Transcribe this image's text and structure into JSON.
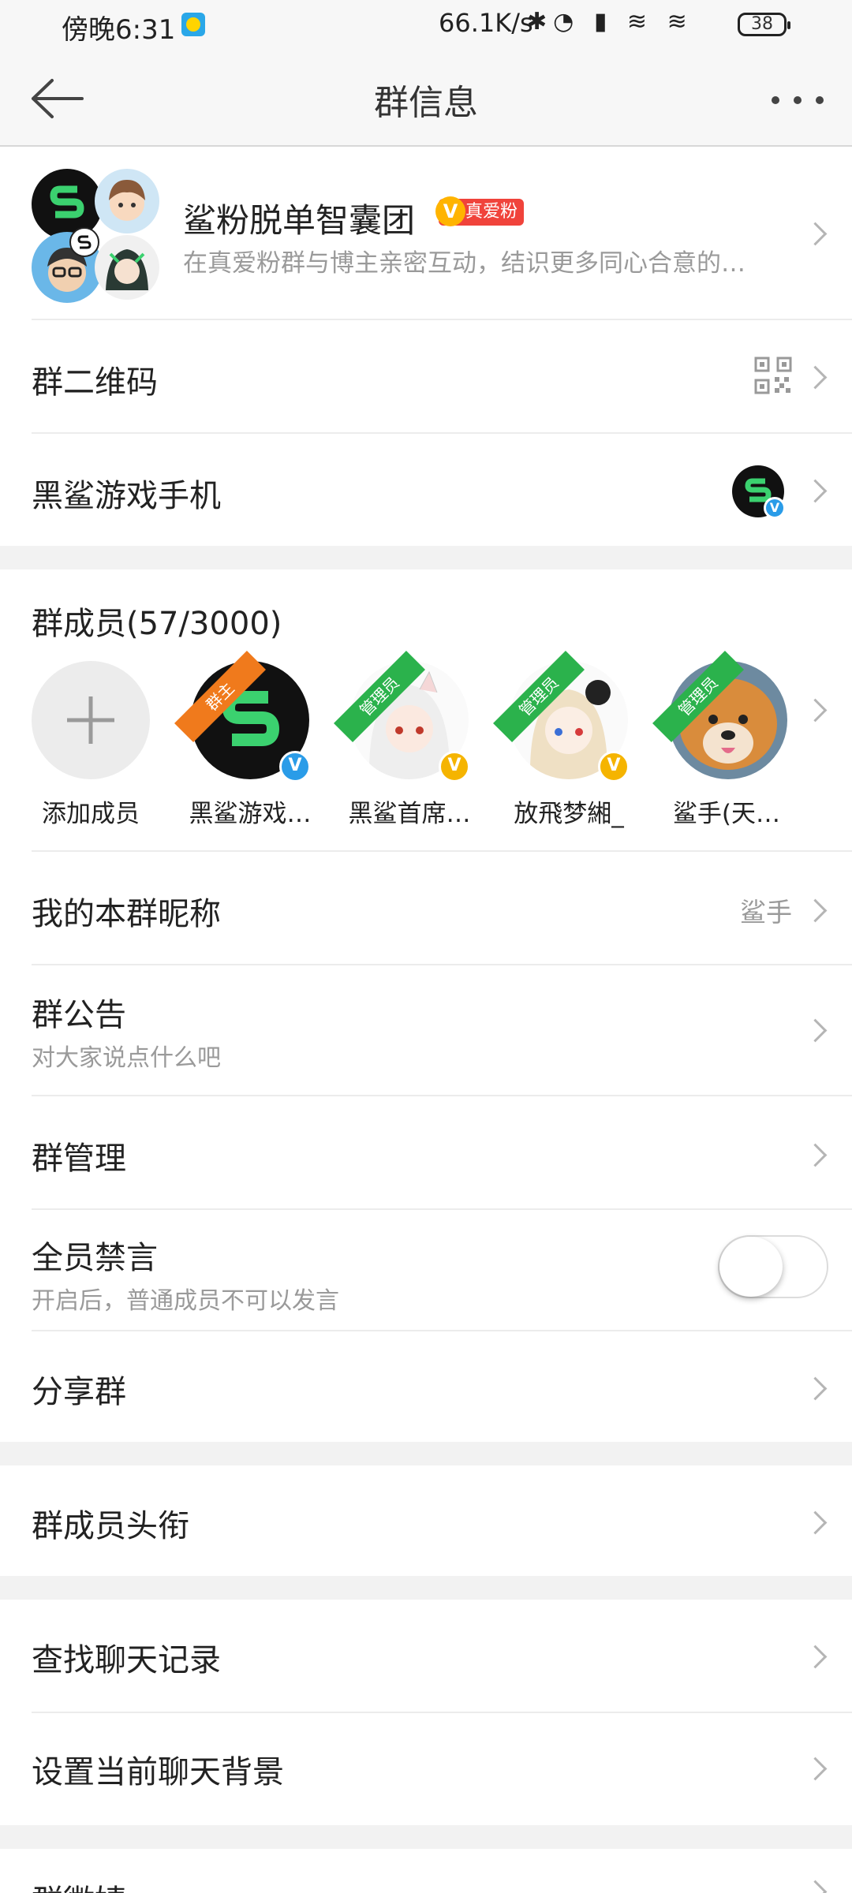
{
  "status_bar": {
    "time": "傍晚6:31",
    "speed": "66.1K/s",
    "battery": "38"
  },
  "nav": {
    "title": "群信息"
  },
  "group": {
    "name": "鲨粉脱单智囊团",
    "badge": "真爱粉",
    "description": "在真爱粉群与博主亲密互动，结识更多同心合意的…"
  },
  "items": {
    "qr_code": "群二维码",
    "owner_account": "黑鲨游戏手机",
    "members_title": "群成员(57/3000)",
    "nickname_label": "我的本群昵称",
    "nickname_value": "鲨手",
    "announcement": "群公告",
    "announcement_hint": "对大家说点什么吧",
    "management": "群管理",
    "mute_all": "全员禁言",
    "mute_all_hint": "开启后，普通成员不可以发言",
    "share_group": "分享群",
    "member_titles": "群成员头衔",
    "search_history": "查找聊天记录",
    "chat_background": "设置当前聊天背景",
    "next_item": "群徽婧"
  },
  "members": [
    {
      "name": "添加成员"
    },
    {
      "name": "黑鲨游戏…",
      "role": "群主"
    },
    {
      "name": "黑鲨首席…",
      "role": "管理员"
    },
    {
      "name": "放飛梦緗_",
      "role": "管理员"
    },
    {
      "name": "鲨手(天…",
      "role": "管理员"
    }
  ],
  "toggles": {
    "mute_all_on": false
  },
  "colors": {
    "owner_ribbon": "#f07a1c",
    "admin_ribbon": "#2bb24c",
    "blue_v": "#2a9ce8",
    "orange_v": "#f5b400",
    "shark_green": "#3bd16f"
  }
}
